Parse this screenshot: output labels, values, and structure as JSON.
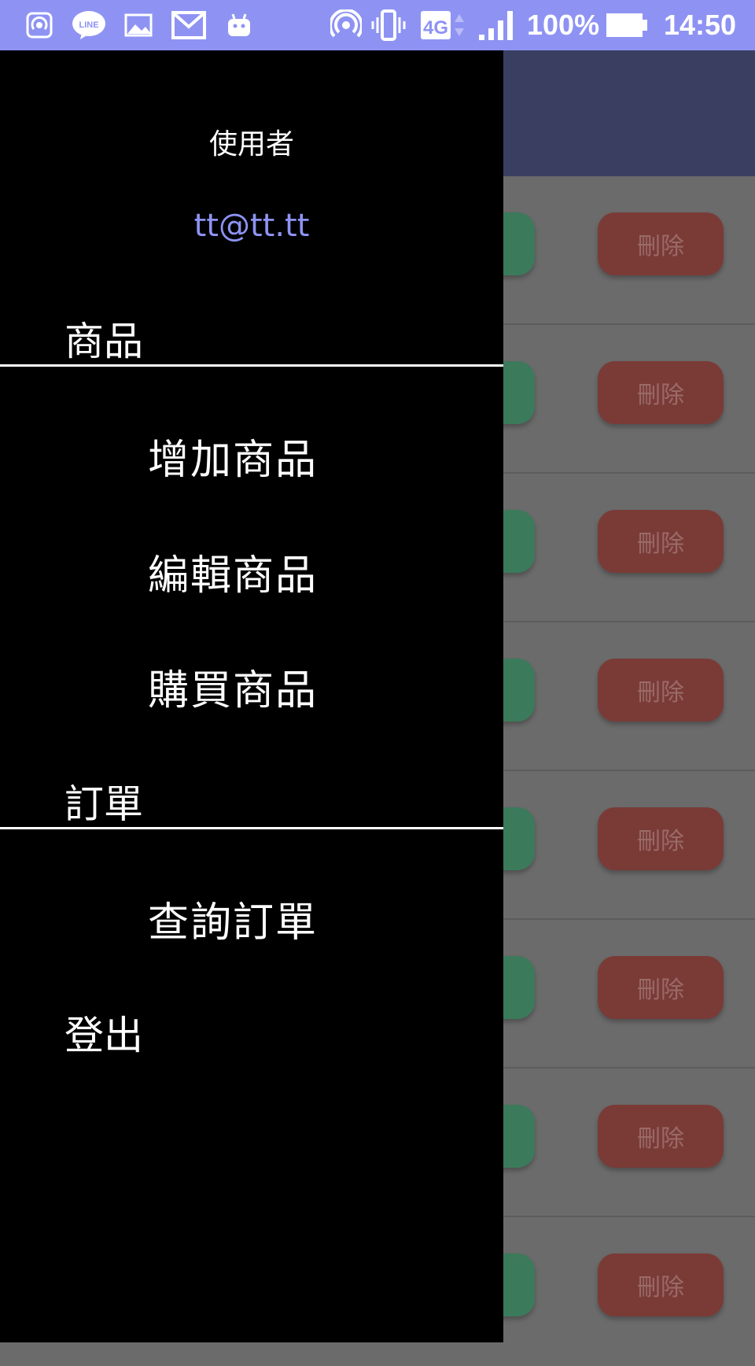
{
  "status_bar": {
    "battery": "100%",
    "time": "14:50",
    "network": "4G",
    "left_icons": [
      "hotspot-icon",
      "line-app-icon",
      "image-icon",
      "gmail-icon",
      "android-icon"
    ],
    "right_icons": [
      "hotspot-icon",
      "vibrate-icon",
      "network-4g-icon",
      "signal-icon",
      "battery-icon"
    ],
    "background_color": "#8e93f3"
  },
  "drawer": {
    "user_label": "使用者",
    "email": "tt@tt.tt",
    "sections": [
      {
        "title": "商品",
        "items": [
          "增加商品",
          "編輯商品",
          "購買商品"
        ]
      },
      {
        "title": "訂單",
        "items": [
          "查詢訂單"
        ]
      }
    ],
    "logout": "登出",
    "email_color": "#8e93f3"
  },
  "list": {
    "delete_label": "刪除",
    "rows": 8,
    "delete_color": "#7a3b37",
    "action_color": "#3b7a5b"
  },
  "header": {
    "color": "#3a3f62"
  }
}
